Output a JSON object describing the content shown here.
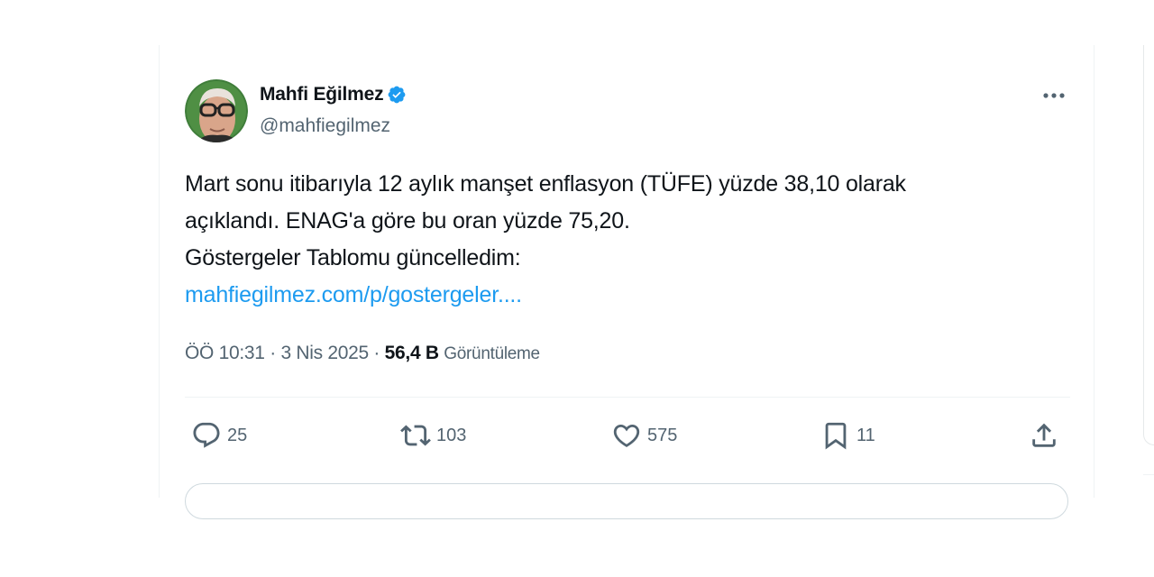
{
  "tweet": {
    "author_name": "Mahfi Eğilmez",
    "author_handle": "@mahfiegilmez",
    "text_lines": [
      "Mart sonu itibarıyla 12 aylık manşet enflasyon (TÜFE) yüzde 38,10 olarak",
      "açıklandı. ENAG'a göre bu oran yüzde 75,20.",
      "Göstergeler Tablomu güncelledim:"
    ],
    "link_text": "mahfiegilmez.com/p/gostergeler....",
    "time": "ÖÖ 10:31",
    "date": "3 Nis 2025",
    "separator": "·",
    "views_count": "56,4 B",
    "views_label": "Görüntüleme"
  },
  "actions": {
    "reply_count": "25",
    "repost_count": "103",
    "like_count": "575",
    "bookmark_count": "11"
  },
  "icons": {
    "verified": "verified-badge-icon",
    "more": "more-dots-icon",
    "reply": "reply-icon",
    "repost": "repost-icon",
    "like": "heart-icon",
    "bookmark": "bookmark-icon",
    "share": "share-icon"
  },
  "colors": {
    "accent": "#1d9bf0",
    "text": "#0f1419",
    "secondary": "#536471",
    "border": "#eff3f4"
  }
}
